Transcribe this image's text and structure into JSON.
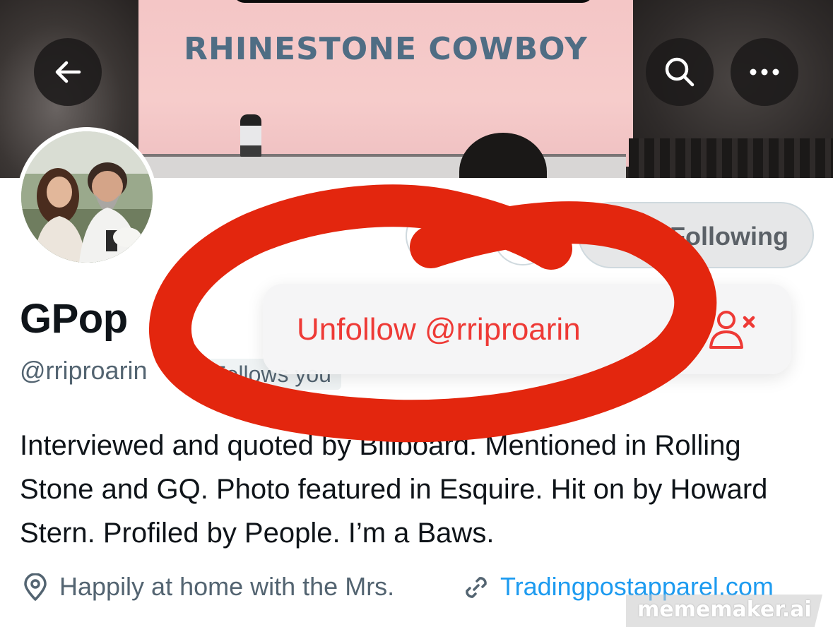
{
  "banner": {
    "screen_text": "RHINESTONE COWBOY"
  },
  "header": {
    "back_icon": "arrow-left-icon",
    "search_icon": "search-icon",
    "more_icon": "more-horizontal-icon"
  },
  "profile": {
    "display_name": "GPop",
    "handle": "@rriproarin",
    "follows_badge": "Follows you",
    "following_button_label": "Following",
    "bio": "Interviewed and quoted by Billboard. Mentioned in Rolling Stone and GQ. Photo featured in Esquire. Hit on by Howard Stern. Profiled by People. I’m a Baws.",
    "location": "Happily at home with the Mrs.",
    "website": "Tradingpostapparel.com",
    "location_icon": "location-pin-icon",
    "link_icon": "link-icon"
  },
  "menu": {
    "unfollow_label": "Unfollow @rriproarin",
    "unfollow_icon": "person-remove-icon"
  },
  "watermark": {
    "text": "mememaker.ai"
  },
  "colors": {
    "annotation_red": "#e3260e",
    "destructive_red": "#ee3a36",
    "link_blue": "#1d9bf0",
    "muted_gray": "#536471"
  }
}
